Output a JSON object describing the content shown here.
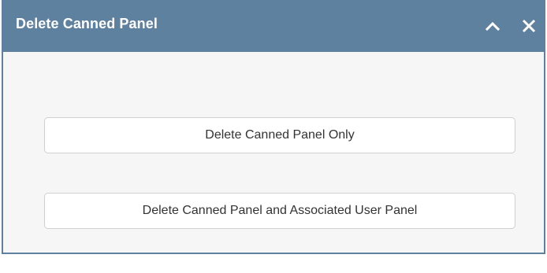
{
  "dialog": {
    "title": "Delete Canned Panel",
    "collapse_icon": "chevron-up-icon",
    "close_icon": "close-icon",
    "buttons": {
      "delete_only": "Delete Canned Panel Only",
      "delete_with_user_panel": "Delete Canned Panel and Associated User Panel"
    }
  },
  "colors": {
    "titlebar": "#5f81a0",
    "body": "#f6f6f6",
    "button_bg": "#ffffff",
    "button_border": "#cfcfcf",
    "text": "#333333"
  }
}
